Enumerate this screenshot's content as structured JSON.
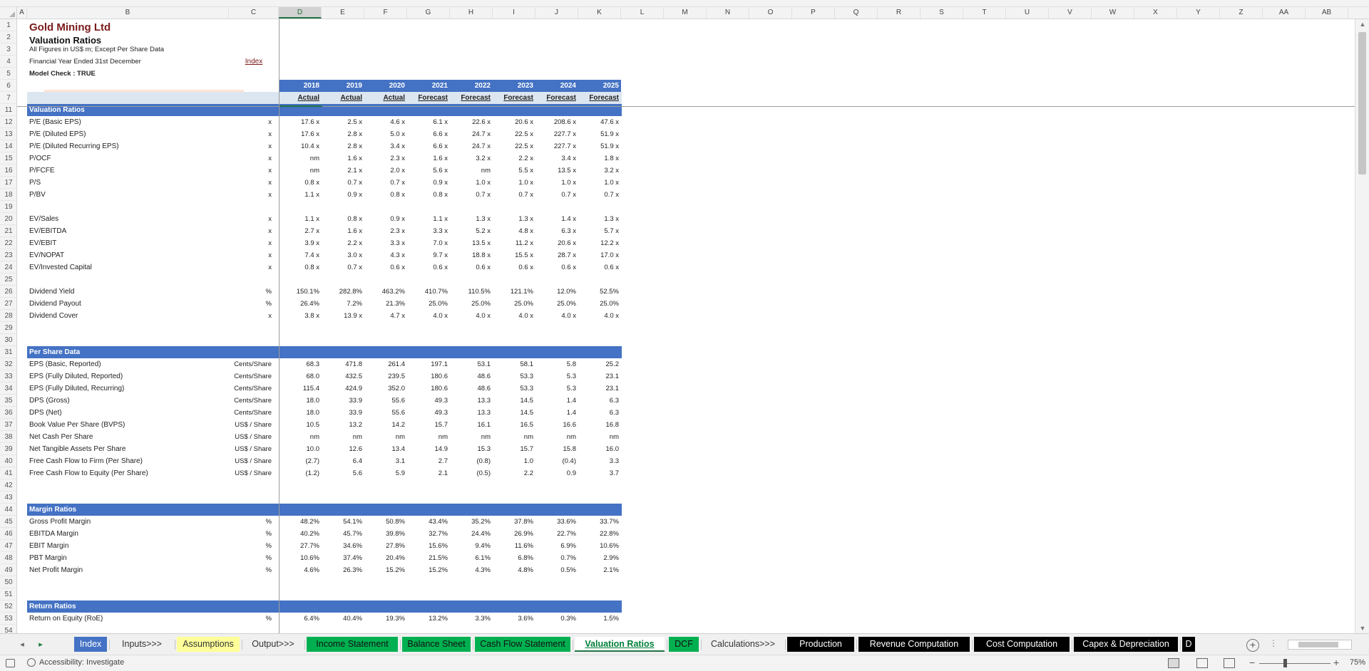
{
  "workbook": {
    "title": "Gold Mining Ltd",
    "subtitle": "Valuation Ratios",
    "note1": "All Figures in US$ m; Except Per Share Data",
    "note2": "Financial Year Ended 31st December",
    "index_link": "Index",
    "model_check": "Model Check : TRUE"
  },
  "columns": [
    "A",
    "B",
    "C",
    "D",
    "E",
    "F",
    "G",
    "H",
    "I",
    "J",
    "K",
    "L",
    "M",
    "N",
    "O",
    "P",
    "Q",
    "R",
    "S",
    "T",
    "U",
    "V",
    "W",
    "X",
    "Y",
    "Z",
    "AA",
    "AB"
  ],
  "years": [
    "2018",
    "2019",
    "2020",
    "2021",
    "2022",
    "2023",
    "2024",
    "2025"
  ],
  "year_types": [
    "Actual",
    "Actual",
    "Actual",
    "Forecast",
    "Forecast",
    "Forecast",
    "Forecast",
    "Forecast"
  ],
  "row_numbers": [
    "1",
    "2",
    "3",
    "4",
    "5",
    "6",
    "7",
    "11",
    "12",
    "13",
    "14",
    "15",
    "16",
    "17",
    "18",
    "19",
    "20",
    "21",
    "22",
    "23",
    "24",
    "25",
    "26",
    "27",
    "28",
    "29",
    "30",
    "31",
    "32",
    "33",
    "34",
    "35",
    "36",
    "37",
    "38",
    "39",
    "40",
    "41",
    "42",
    "43",
    "44",
    "45",
    "46",
    "47",
    "48",
    "49",
    "50",
    "51",
    "52",
    "53",
    "54"
  ],
  "rows": [
    {
      "r": "11",
      "type": "section",
      "label": "Valuation Ratios"
    },
    {
      "r": "12",
      "label": "P/E (Basic EPS)",
      "unit": "x",
      "v": [
        "17.6 x",
        "2.5 x",
        "4.6 x",
        "6.1 x",
        "22.6 x",
        "20.6 x",
        "208.6 x",
        "47.6 x"
      ]
    },
    {
      "r": "13",
      "label": "P/E (Diluted EPS)",
      "unit": "x",
      "v": [
        "17.6 x",
        "2.8 x",
        "5.0 x",
        "6.6 x",
        "24.7 x",
        "22.5 x",
        "227.7 x",
        "51.9 x"
      ]
    },
    {
      "r": "14",
      "label": "P/E (Diluted Recurring EPS)",
      "unit": "x",
      "v": [
        "10.4 x",
        "2.8 x",
        "3.4 x",
        "6.6 x",
        "24.7 x",
        "22.5 x",
        "227.7 x",
        "51.9 x"
      ]
    },
    {
      "r": "15",
      "label": "P/OCF",
      "unit": "x",
      "v": [
        "nm",
        "1.6 x",
        "2.3 x",
        "1.6 x",
        "3.2 x",
        "2.2 x",
        "3.4 x",
        "1.8 x"
      ]
    },
    {
      "r": "16",
      "label": "P/FCFE",
      "unit": "x",
      "v": [
        "nm",
        "2.1 x",
        "2.0 x",
        "5.6 x",
        "nm",
        "5.5 x",
        "13.5 x",
        "3.2 x"
      ]
    },
    {
      "r": "17",
      "label": "P/S",
      "unit": "x",
      "v": [
        "0.8 x",
        "0.7 x",
        "0.7 x",
        "0.9 x",
        "1.0 x",
        "1.0 x",
        "1.0 x",
        "1.0 x"
      ]
    },
    {
      "r": "18",
      "label": "P/BV",
      "unit": "x",
      "v": [
        "1.1 x",
        "0.9 x",
        "0.8 x",
        "0.8 x",
        "0.7 x",
        "0.7 x",
        "0.7 x",
        "0.7 x"
      ]
    },
    {
      "r": "19",
      "type": "blank"
    },
    {
      "r": "20",
      "label": "EV/Sales",
      "unit": "x",
      "v": [
        "1.1 x",
        "0.8 x",
        "0.9 x",
        "1.1 x",
        "1.3 x",
        "1.3 x",
        "1.4 x",
        "1.3 x"
      ]
    },
    {
      "r": "21",
      "label": "EV/EBITDA",
      "unit": "x",
      "v": [
        "2.7 x",
        "1.6 x",
        "2.3 x",
        "3.3 x",
        "5.2 x",
        "4.8 x",
        "6.3 x",
        "5.7 x"
      ]
    },
    {
      "r": "22",
      "label": "EV/EBIT",
      "unit": "x",
      "v": [
        "3.9 x",
        "2.2 x",
        "3.3 x",
        "7.0 x",
        "13.5 x",
        "11.2 x",
        "20.6 x",
        "12.2 x"
      ]
    },
    {
      "r": "23",
      "label": "EV/NOPAT",
      "unit": "x",
      "v": [
        "7.4 x",
        "3.0 x",
        "4.3 x",
        "9.7 x",
        "18.8 x",
        "15.5 x",
        "28.7 x",
        "17.0 x"
      ]
    },
    {
      "r": "24",
      "label": "EV/Invested Capital",
      "unit": "x",
      "v": [
        "0.8 x",
        "0.7 x",
        "0.6 x",
        "0.6 x",
        "0.6 x",
        "0.6 x",
        "0.6 x",
        "0.6 x"
      ]
    },
    {
      "r": "25",
      "type": "blank"
    },
    {
      "r": "26",
      "label": "Dividend Yield",
      "unit": "%",
      "v": [
        "150.1%",
        "282.8%",
        "463.2%",
        "410.7%",
        "110.5%",
        "121.1%",
        "12.0%",
        "52.5%"
      ]
    },
    {
      "r": "27",
      "label": "Dividend Payout",
      "unit": "%",
      "v": [
        "26.4%",
        "7.2%",
        "21.3%",
        "25.0%",
        "25.0%",
        "25.0%",
        "25.0%",
        "25.0%"
      ]
    },
    {
      "r": "28",
      "label": "Dividend Cover",
      "unit": "x",
      "v": [
        "3.8 x",
        "13.9 x",
        "4.7 x",
        "4.0 x",
        "4.0 x",
        "4.0 x",
        "4.0 x",
        "4.0 x"
      ]
    },
    {
      "r": "29",
      "type": "blank"
    },
    {
      "r": "30",
      "type": "blank"
    },
    {
      "r": "31",
      "type": "section",
      "label": "Per Share Data"
    },
    {
      "r": "32",
      "label": "EPS (Basic, Reported)",
      "unit": "Cents/Share",
      "v": [
        "68.3",
        "471.8",
        "261.4",
        "197.1",
        "53.1",
        "58.1",
        "5.8",
        "25.2"
      ]
    },
    {
      "r": "33",
      "label": "EPS (Fully Diluted, Reported)",
      "unit": "Cents/Share",
      "v": [
        "68.0",
        "432.5",
        "239.5",
        "180.6",
        "48.6",
        "53.3",
        "5.3",
        "23.1"
      ]
    },
    {
      "r": "34",
      "label": "EPS (Fully Diluted, Recurring)",
      "unit": "Cents/Share",
      "v": [
        "115.4",
        "424.9",
        "352.0",
        "180.6",
        "48.6",
        "53.3",
        "5.3",
        "23.1"
      ]
    },
    {
      "r": "35",
      "label": "DPS (Gross)",
      "unit": "Cents/Share",
      "v": [
        "18.0",
        "33.9",
        "55.6",
        "49.3",
        "13.3",
        "14.5",
        "1.4",
        "6.3"
      ]
    },
    {
      "r": "36",
      "label": "DPS (Net)",
      "unit": "Cents/Share",
      "v": [
        "18.0",
        "33.9",
        "55.6",
        "49.3",
        "13.3",
        "14.5",
        "1.4",
        "6.3"
      ]
    },
    {
      "r": "37",
      "label": "Book Value Per Share (BVPS)",
      "unit": "US$ / Share",
      "v": [
        "10.5",
        "13.2",
        "14.2",
        "15.7",
        "16.1",
        "16.5",
        "16.6",
        "16.8"
      ]
    },
    {
      "r": "38",
      "label": "Net Cash Per Share",
      "unit": "US$ / Share",
      "v": [
        "nm",
        "nm",
        "nm",
        "nm",
        "nm",
        "nm",
        "nm",
        "nm"
      ]
    },
    {
      "r": "39",
      "label": "Net Tangible Assets Per Share",
      "unit": "US$ / Share",
      "v": [
        "10.0",
        "12.6",
        "13.4",
        "14.9",
        "15.3",
        "15.7",
        "15.8",
        "16.0"
      ]
    },
    {
      "r": "40",
      "label": "Free Cash Flow to Firm (Per Share)",
      "unit": "US$ / Share",
      "v": [
        "(2.7)",
        "6.4",
        "3.1",
        "2.7",
        "(0.8)",
        "1.0",
        "(0.4)",
        "3.3"
      ]
    },
    {
      "r": "41",
      "label": "Free Cash Flow to Equity (Per Share)",
      "unit": "US$ / Share",
      "v": [
        "(1.2)",
        "5.6",
        "5.9",
        "2.1",
        "(0.5)",
        "2.2",
        "0.9",
        "3.7"
      ]
    },
    {
      "r": "42",
      "type": "blank"
    },
    {
      "r": "43",
      "type": "blank"
    },
    {
      "r": "44",
      "type": "section",
      "label": "Margin Ratios"
    },
    {
      "r": "45",
      "label": "Gross Profit Margin",
      "unit": "%",
      "v": [
        "48.2%",
        "54.1%",
        "50.8%",
        "43.4%",
        "35.2%",
        "37.8%",
        "33.6%",
        "33.7%"
      ]
    },
    {
      "r": "46",
      "label": "EBITDA Margin",
      "unit": "%",
      "v": [
        "40.2%",
        "45.7%",
        "39.8%",
        "32.7%",
        "24.4%",
        "26.9%",
        "22.7%",
        "22.8%"
      ]
    },
    {
      "r": "47",
      "label": "EBIT Margin",
      "unit": "%",
      "v": [
        "27.7%",
        "34.6%",
        "27.8%",
        "15.6%",
        "9.4%",
        "11.6%",
        "6.9%",
        "10.6%"
      ]
    },
    {
      "r": "48",
      "label": "PBT Margin",
      "unit": "%",
      "v": [
        "10.6%",
        "37.4%",
        "20.4%",
        "21.5%",
        "6.1%",
        "6.8%",
        "0.7%",
        "2.9%"
      ]
    },
    {
      "r": "49",
      "label": "Net Profit Margin",
      "unit": "%",
      "v": [
        "4.6%",
        "26.3%",
        "15.2%",
        "15.2%",
        "4.3%",
        "4.8%",
        "0.5%",
        "2.1%"
      ]
    },
    {
      "r": "50",
      "type": "blank"
    },
    {
      "r": "51",
      "type": "blank"
    },
    {
      "r": "52",
      "type": "section",
      "label": "Return Ratios"
    },
    {
      "r": "53",
      "label": "Return on Equity (RoE)",
      "unit": "%",
      "v": [
        "6.4%",
        "40.4%",
        "19.3%",
        "13.2%",
        "3.3%",
        "3.6%",
        "0.3%",
        "1.5%"
      ]
    }
  ],
  "sheet_tabs": [
    {
      "label": "Index",
      "style": "index"
    },
    {
      "label": "Inputs>>>",
      "style": "plain"
    },
    {
      "label": "Assumptions",
      "style": "yellow"
    },
    {
      "label": "Output>>>",
      "style": "plain"
    },
    {
      "label": "Income Statement",
      "style": "green"
    },
    {
      "label": "Balance Sheet",
      "style": "green"
    },
    {
      "label": "Cash Flow Statement",
      "style": "green"
    },
    {
      "label": "Valuation Ratios",
      "style": "active"
    },
    {
      "label": "DCF",
      "style": "green"
    },
    {
      "label": "Calculations>>>",
      "style": "plain"
    },
    {
      "label": "Production",
      "style": "black"
    },
    {
      "label": "Revenue Computation",
      "style": "black"
    },
    {
      "label": "Cost Computation",
      "style": "black"
    },
    {
      "label": "Capex & Depreciation",
      "style": "black"
    },
    {
      "label": "D",
      "style": "black"
    }
  ],
  "tab_more": "...",
  "status": {
    "accessibility": "Accessibility: Investigate",
    "zoom": "75%"
  },
  "colors": {
    "section_blue": "#4472c4",
    "header_pale": "#dce6f1",
    "title_red": "#7b1a1a",
    "check_peach": "#fce4d6",
    "tab_green": "#00b050",
    "tab_yellow": "#ffff99"
  }
}
